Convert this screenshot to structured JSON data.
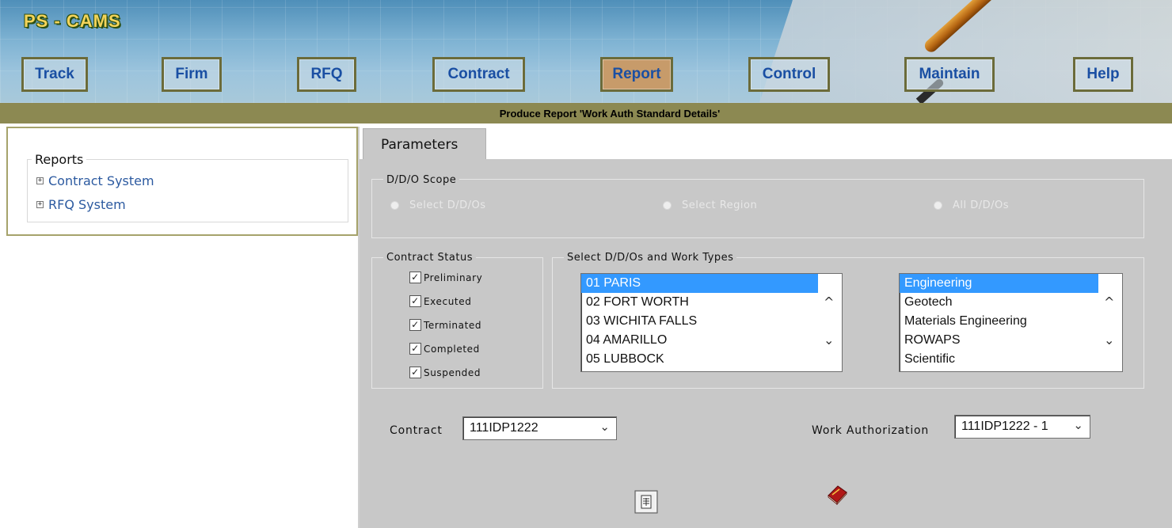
{
  "app": {
    "title": "PS - CAMS",
    "subtitle": "Produce Report 'Work Auth Standard Details'"
  },
  "nav": {
    "track": "Track",
    "firm": "Firm",
    "rfq": "RFQ",
    "contract": "Contract",
    "report": "Report",
    "control": "Control",
    "maintain": "Maintain",
    "help": "Help"
  },
  "sidebar": {
    "legend": "Reports",
    "items": [
      {
        "label": "Contract System",
        "expander": "+"
      },
      {
        "label": "RFQ System",
        "expander": "+"
      }
    ]
  },
  "tab": {
    "label": "Parameters"
  },
  "scope": {
    "legend": "D/D/O Scope",
    "options": [
      "Select D/D/Os",
      "Select Region",
      "All D/D/Os"
    ]
  },
  "contract_status": {
    "legend": "Contract Status",
    "items": [
      {
        "label": "Preliminary",
        "checked": true
      },
      {
        "label": "Executed",
        "checked": true
      },
      {
        "label": "Terminated",
        "checked": true
      },
      {
        "label": "Completed",
        "checked": true
      },
      {
        "label": "Suspended",
        "checked": true
      }
    ],
    "check_glyph": "✓"
  },
  "ddo_work": {
    "legend": "Select D/D/Os and Work Types",
    "ddos": [
      "01 PARIS",
      "02 FORT WORTH",
      "03 WICHITA FALLS",
      "04 AMARILLO",
      "05 LUBBOCK"
    ],
    "work_types": [
      "Engineering",
      "Geotech",
      "Materials Engineering",
      "ROWAPS",
      "Scientific"
    ],
    "scroll_up": "^",
    "scroll_down": "⌄"
  },
  "contract": {
    "label": "Contract",
    "value": "111IDP1222",
    "chevron": "⌄"
  },
  "work_auth": {
    "label": "Work Authorization",
    "value": "111IDP1222 - 1",
    "chevron": "⌄"
  },
  "icons": {
    "preview": "report-preview-icon",
    "run": "run-report-book-icon"
  },
  "colors": {
    "header_bar": "#8c8952",
    "panel": "#c8c8c8",
    "selection": "#3399ff",
    "nav_text": "#1a4fa3",
    "active_nav": "#c79b6a"
  }
}
